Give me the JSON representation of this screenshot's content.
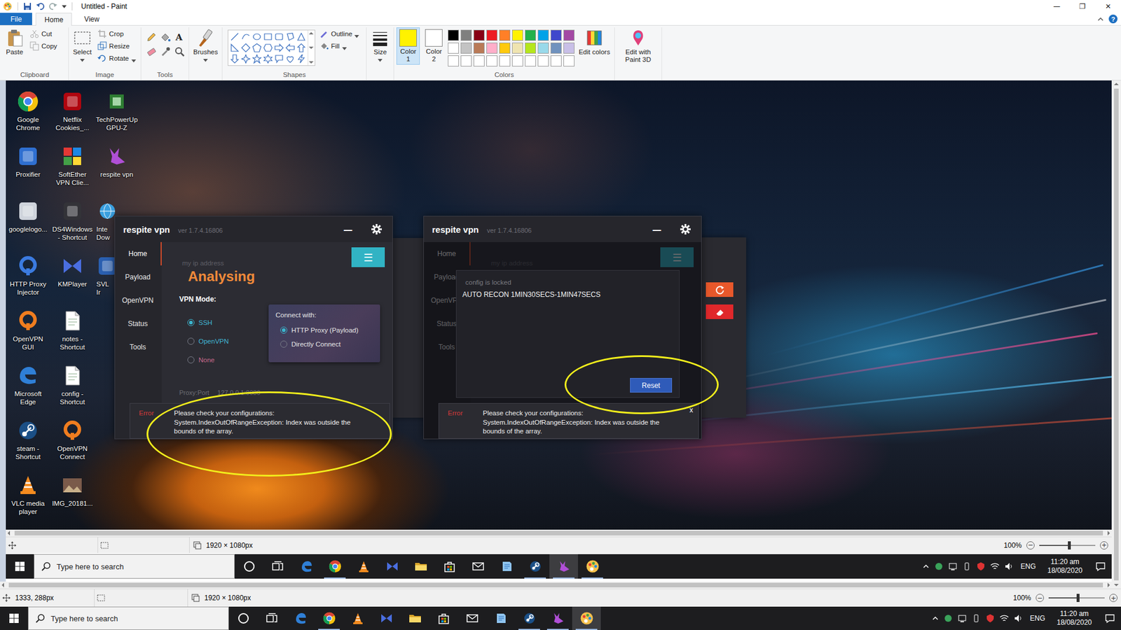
{
  "window": {
    "title": "Untitled - Paint",
    "controls": [
      "—",
      "❐",
      "✕"
    ]
  },
  "ribbon_tabs": [
    {
      "label": "File",
      "selected": false
    },
    {
      "label": "Home",
      "selected": true
    },
    {
      "label": "View",
      "selected": false
    }
  ],
  "help": "?",
  "ribbon": {
    "groups": [
      {
        "label": "Clipboard",
        "items": [
          {
            "kind": "large",
            "label": "Paste",
            "disabled": false,
            "dropdown": false
          },
          {
            "kind": "small",
            "label": "Cut",
            "disabled": true,
            "dropdown": false
          },
          {
            "kind": "small",
            "label": "Copy",
            "disabled": true,
            "dropdown": false
          }
        ]
      },
      {
        "label": "Image",
        "items": [
          {
            "kind": "large",
            "label": "Select",
            "disabled": false,
            "dropdown": true
          },
          {
            "kind": "small",
            "label": "Crop",
            "disabled": true,
            "dropdown": false
          },
          {
            "kind": "small",
            "label": "Resize",
            "disabled": false,
            "dropdown": false
          },
          {
            "kind": "small",
            "label": "Rotate",
            "disabled": false,
            "dropdown": true
          }
        ]
      },
      {
        "label": "Tools",
        "items": [
          {
            "kind": "tools",
            "text_tool": "A"
          }
        ]
      },
      {
        "items": [
          {
            "kind": "large",
            "label": "Brushes",
            "disabled": false,
            "dropdown": true
          }
        ]
      },
      {
        "label": "Shapes",
        "items": [
          {
            "kind": "shapes"
          },
          {
            "kind": "small",
            "label": "Outline",
            "disabled": false,
            "dropdown": true
          },
          {
            "kind": "small",
            "label": "Fill",
            "disabled": false,
            "dropdown": true
          }
        ]
      },
      {
        "items": [
          {
            "kind": "large",
            "label": "Size",
            "disabled": false,
            "dropdown": true
          }
        ]
      },
      {
        "label": "Colors",
        "items": [
          {
            "kind": "color",
            "label": "Color 1",
            "color": "#fff200",
            "selected": true
          },
          {
            "kind": "color",
            "label": "Color 2",
            "color": "#ffffff",
            "selected": false
          },
          {
            "kind": "palette",
            "colors": [
              {
                "color": "#000000"
              },
              {
                "color": "#7f7f7f"
              },
              {
                "color": "#880015"
              },
              {
                "color": "#ed1c24"
              },
              {
                "color": "#ff7f27"
              },
              {
                "color": "#fff200"
              },
              {
                "color": "#22b14c"
              },
              {
                "color": "#00a2e8"
              },
              {
                "color": "#3f48cc"
              },
              {
                "color": "#a349a4"
              },
              {
                "color": "#ffffff"
              },
              {
                "color": "#c3c3c3"
              },
              {
                "color": "#b97a57"
              },
              {
                "color": "#ffaec9"
              },
              {
                "color": "#ffc90e"
              },
              {
                "color": "#efe4b0"
              },
              {
                "color": "#b5e61d"
              },
              {
                "color": "#99d9ea"
              },
              {
                "color": "#7092be"
              },
              {
                "color": "#c8bfe7"
              },
              {
                "color": "#ffffff"
              },
              {
                "color": "#ffffff"
              },
              {
                "color": "#ffffff"
              },
              {
                "color": "#ffffff"
              },
              {
                "color": "#ffffff"
              },
              {
                "color": "#ffffff"
              },
              {
                "color": "#ffffff"
              },
              {
                "color": "#ffffff"
              },
              {
                "color": "#ffffff"
              },
              {
                "color": "#ffffff"
              }
            ]
          },
          {
            "kind": "large",
            "label": "Edit colors",
            "disabled": false,
            "dropdown": false
          }
        ]
      },
      {
        "items": [
          {
            "kind": "large",
            "label": "Edit with Paint 3D",
            "disabled": false,
            "dropdown": false
          }
        ]
      }
    ]
  },
  "desktop": {
    "columns": [
      [
        {
          "label": "Google Chrome",
          "kind": "full"
        },
        {
          "label": "Proxifier",
          "kind": "full"
        },
        {
          "label": "googlelogo...",
          "kind": "full"
        },
        {
          "label": "HTTP Proxy Injector",
          "kind": "full"
        },
        {
          "label": "OpenVPN GUI",
          "kind": "full"
        },
        {
          "label": "Microsoft Edge",
          "kind": "full"
        },
        {
          "label": "steam - Shortcut",
          "kind": "full"
        },
        {
          "label": "VLC media player",
          "kind": "full"
        }
      ],
      [
        {
          "label": "Netflix Cookies_...",
          "kind": "full"
        },
        {
          "label": "SoftEther VPN Clie...",
          "kind": "full"
        },
        {
          "label": "DS4Windows - Shortcut",
          "kind": "full"
        },
        {
          "label": "KMPlayer",
          "kind": "full"
        },
        {
          "label": "notes - Shortcut",
          "kind": "full"
        },
        {
          "label": "config - Shortcut",
          "kind": "full"
        },
        {
          "label": "OpenVPN Connect",
          "kind": "full"
        },
        {
          "label": "IMG_20181...",
          "kind": "full"
        }
      ],
      [
        {
          "label": "TechPowerUp GPU-Z",
          "kind": "full"
        },
        {
          "label": "respite vpn",
          "kind": "full"
        },
        {
          "label": "Inte Dow",
          "kind": "partial"
        },
        {
          "label": "SVL Ir",
          "kind": "partial"
        }
      ]
    ]
  },
  "vpn_windows": [
    {
      "title": "respite vpn",
      "version": "ver 1.7.4.16806",
      "minimize": "—",
      "nav": [
        {
          "label": "Home",
          "selected": true
        },
        {
          "label": "Payload",
          "selected": false
        },
        {
          "label": "OpenVPN",
          "selected": false
        },
        {
          "label": "Status",
          "selected": false
        },
        {
          "label": "Tools",
          "selected": false
        }
      ],
      "ip_label": "my ip address",
      "status": "Analysing",
      "menu_button": "☰",
      "vpn_mode": {
        "label": "VPN Mode:",
        "options": [
          {
            "label": "SSH",
            "selected": true,
            "color": "#41b6d3"
          },
          {
            "label": "OpenVPN",
            "selected": false,
            "color": "#41b6d3"
          },
          {
            "label": "None",
            "selected": false,
            "color": "#c86b8d"
          }
        ]
      },
      "connect_with": {
        "label": "Connect with:",
        "options": [
          {
            "label": "HTTP Proxy (Payload)",
            "selected": true
          },
          {
            "label": "Directly Connect",
            "selected": false
          }
        ]
      },
      "proxy": {
        "label": "Proxy:Port",
        "value": "127.0.0.1:8080"
      },
      "error": {
        "tag": "Error",
        "lines": [
          "Please check your configurations:",
          "System.IndexOutOfRangeException: Index was outside the",
          "bounds of the array."
        ]
      }
    },
    {
      "title": "respite vpn",
      "version": "ver 1.7.4.16806",
      "minimize": "—",
      "nav": [
        {
          "label": "Home",
          "selected": true
        },
        {
          "label": "Payload",
          "selected": false
        },
        {
          "label": "OpenVPN",
          "selected": false
        },
        {
          "label": "Status",
          "selected": false
        },
        {
          "label": "Tools",
          "selected": false
        }
      ],
      "ip_label": "my ip address",
      "menu_button": "☰",
      "dialog": {
        "title": "config is locked",
        "text": "AUTO RECON 1MIN30SECS-1MIN47SECS",
        "button": "Reset"
      },
      "error": {
        "tag": "Error",
        "lines": [
          "Please check your configurations:",
          "System.IndexOutOfRangeException: Index was outside the",
          "bounds of the array."
        ],
        "close": "x"
      }
    }
  ],
  "screenshot_status": {
    "size": "1920 × 1080px",
    "zoom": "100%",
    "zoom_out": "−",
    "zoom_in": "+",
    "zoom_level": 0.53
  },
  "status_bar": {
    "cursor": "1333, 288px",
    "size": "1920 × 1080px",
    "zoom": "100%",
    "zoom_out": "−",
    "zoom_in": "+",
    "zoom_level": 0.52
  },
  "taskbars": [
    {
      "search": {
        "placeholder": "Type here to search"
      },
      "apps": [
        {
          "running": false,
          "selected": false
        },
        {
          "running": false,
          "selected": false
        },
        {
          "running": false,
          "selected": false
        },
        {
          "running": true,
          "selected": false
        },
        {
          "running": false,
          "selected": false
        },
        {
          "running": false,
          "selected": false
        },
        {
          "running": false,
          "selected": false
        },
        {
          "running": false,
          "selected": false
        },
        {
          "running": false,
          "selected": false
        },
        {
          "running": false,
          "selected": false
        },
        {
          "running": true,
          "selected": false
        },
        {
          "running": true,
          "selected": true
        },
        {
          "running": true,
          "selected": false
        }
      ],
      "tray": {
        "lang": "ENG",
        "time": "11:20 am",
        "date": "18/08/2020"
      }
    },
    {
      "search": {
        "placeholder": "Type here to search"
      },
      "apps": [
        {
          "running": false,
          "selected": false
        },
        {
          "running": false,
          "selected": false
        },
        {
          "running": false,
          "selected": false
        },
        {
          "running": true,
          "selected": false
        },
        {
          "running": false,
          "selected": false
        },
        {
          "running": false,
          "selected": false
        },
        {
          "running": false,
          "selected": false
        },
        {
          "running": false,
          "selected": false
        },
        {
          "running": false,
          "selected": false
        },
        {
          "running": false,
          "selected": false
        },
        {
          "running": true,
          "selected": false
        },
        {
          "running": true,
          "selected": false
        },
        {
          "running": true,
          "selected": true
        }
      ],
      "tray": {
        "lang": "ENG",
        "time": "11:20 am",
        "date": "18/08/2020"
      }
    }
  ]
}
